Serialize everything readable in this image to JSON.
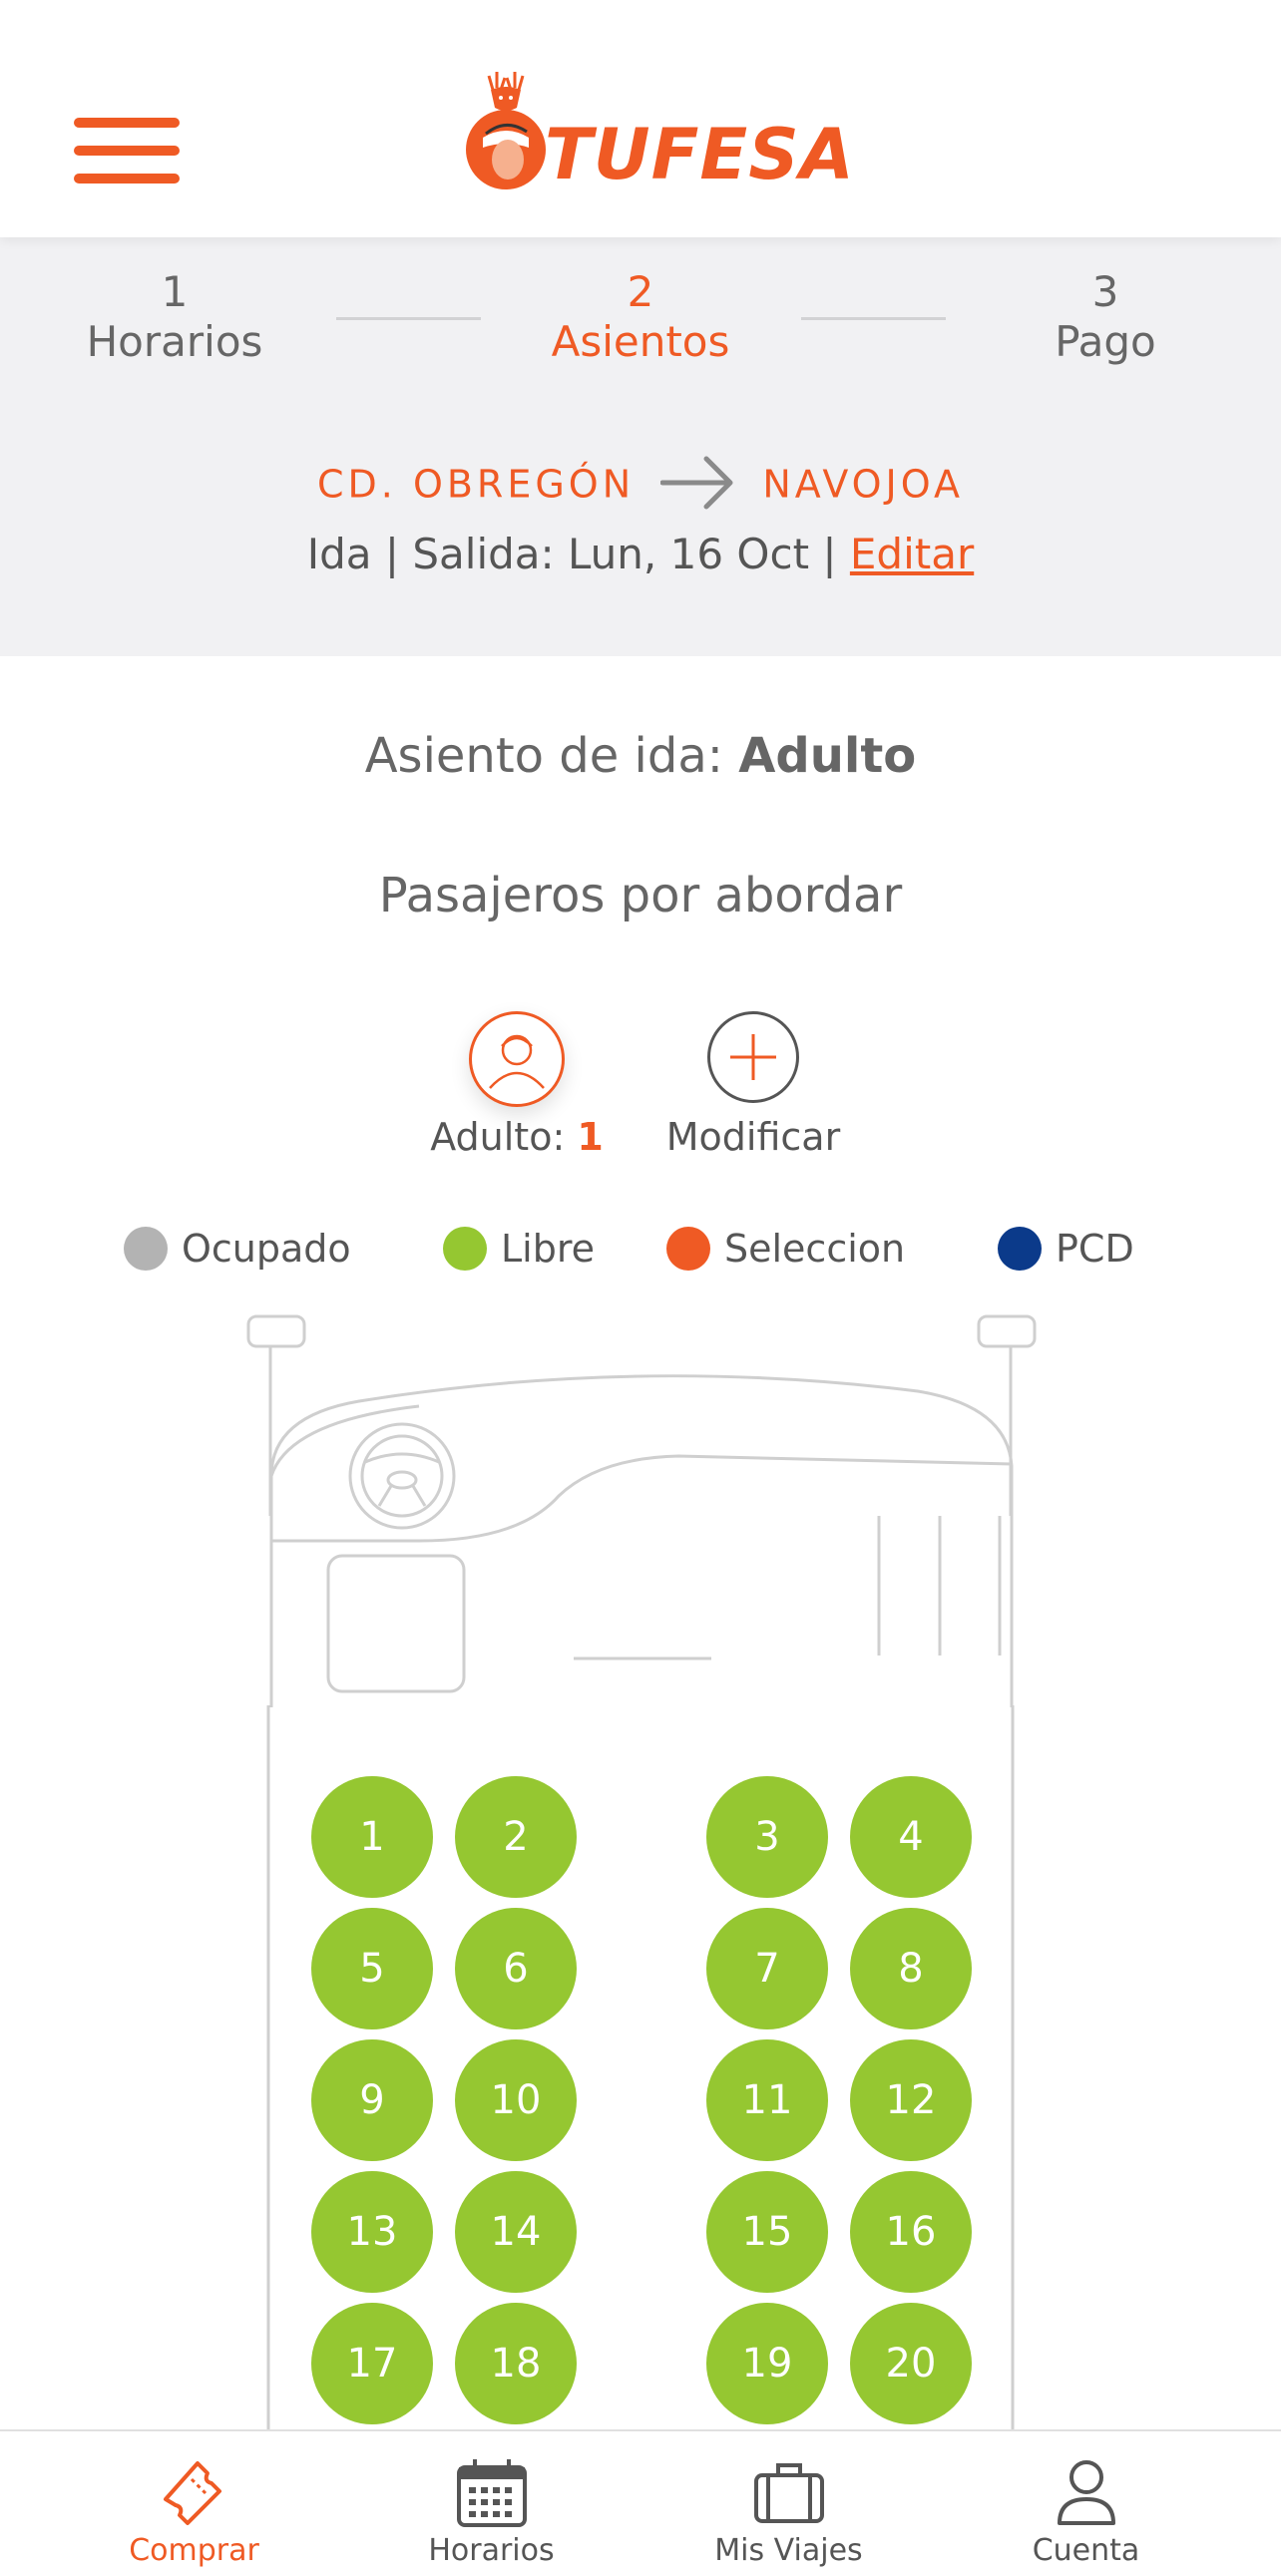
{
  "brand": {
    "name": "TUFESA",
    "accent": "#ef5a24"
  },
  "steps": [
    {
      "number": "1",
      "label": "Horarios",
      "active": false
    },
    {
      "number": "2",
      "label": "Asientos",
      "active": true
    },
    {
      "number": "3",
      "label": "Pago",
      "active": false
    }
  ],
  "route": {
    "origin": "CD. OBREGÓN",
    "destination": "NAVOJOA"
  },
  "trip": {
    "summary": "Ida | Salida: Lun, 16 Oct | ",
    "edit_label": "Editar"
  },
  "seat_heading": {
    "prefix": "Asiento de ida: ",
    "type": "Adulto"
  },
  "passengers": {
    "heading": "Pasajeros por abordar",
    "adult_label": "Adulto: ",
    "adult_count": "1",
    "modify_label": "Modificar"
  },
  "legend": [
    {
      "label": "Ocupado",
      "color": "#b3b3b3"
    },
    {
      "label": "Libre",
      "color": "#95c731"
    },
    {
      "label": "Seleccion",
      "color": "#ef5a24"
    },
    {
      "label": "PCD",
      "color": "#0b3a8a"
    }
  ],
  "seats": [
    {
      "number": "1",
      "status": "Libre"
    },
    {
      "number": "2",
      "status": "Libre"
    },
    {
      "number": "3",
      "status": "Libre"
    },
    {
      "number": "4",
      "status": "Libre"
    },
    {
      "number": "5",
      "status": "Libre"
    },
    {
      "number": "6",
      "status": "Libre"
    },
    {
      "number": "7",
      "status": "Libre"
    },
    {
      "number": "8",
      "status": "Libre"
    },
    {
      "number": "9",
      "status": "Libre"
    },
    {
      "number": "10",
      "status": "Libre"
    },
    {
      "number": "11",
      "status": "Libre"
    },
    {
      "number": "12",
      "status": "Libre"
    },
    {
      "number": "13",
      "status": "Libre"
    },
    {
      "number": "14",
      "status": "Libre"
    },
    {
      "number": "15",
      "status": "Libre"
    },
    {
      "number": "16",
      "status": "Libre"
    },
    {
      "number": "17",
      "status": "Libre"
    },
    {
      "number": "18",
      "status": "Libre"
    },
    {
      "number": "19",
      "status": "Libre"
    },
    {
      "number": "20",
      "status": "Libre"
    }
  ],
  "nav": [
    {
      "label": "Comprar",
      "icon": "ticket-icon",
      "active": true
    },
    {
      "label": "Horarios",
      "icon": "calendar-icon",
      "active": false
    },
    {
      "label": "Mis Viajes",
      "icon": "suitcase-icon",
      "active": false
    },
    {
      "label": "Cuenta",
      "icon": "user-icon",
      "active": false
    }
  ]
}
